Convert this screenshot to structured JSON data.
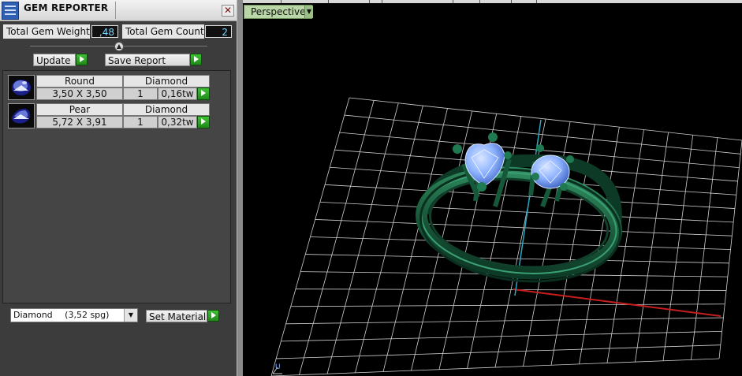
{
  "panel": {
    "title": "GEM REPORTER",
    "close_glyph": "✕",
    "total_weight_label": "Total Gem Weight",
    "total_weight_value": ",48",
    "total_count_label": "Total Gem Count",
    "total_count_value": "2",
    "update_label": "Update",
    "save_report_label": "Save Report",
    "gems": [
      {
        "shape": "Round",
        "material": "Diamond",
        "size": "3,50 X 3,50",
        "qty": "1",
        "weight": "0,16tw"
      },
      {
        "shape": "Pear",
        "material": "Diamond",
        "size": "5,72 X 3,91",
        "qty": "1",
        "weight": "0,32tw"
      }
    ],
    "material_select": {
      "value": "Diamond",
      "spg": "(3,52 spg)"
    },
    "set_material_label": "Set Material"
  },
  "viewport": {
    "view_mode": "Perspective",
    "axis_label": "U",
    "colors": {
      "ring": "#1f6b47",
      "gem": "#8fb4ff",
      "grid": "#d8d8d8",
      "x_axis": "#c81e1e",
      "y_axis": "#2aa9c4"
    }
  },
  "icons": [
    "app-icon",
    "close-icon",
    "play-icon",
    "chevron-down-icon",
    "gem-thumbnail-icon"
  ]
}
